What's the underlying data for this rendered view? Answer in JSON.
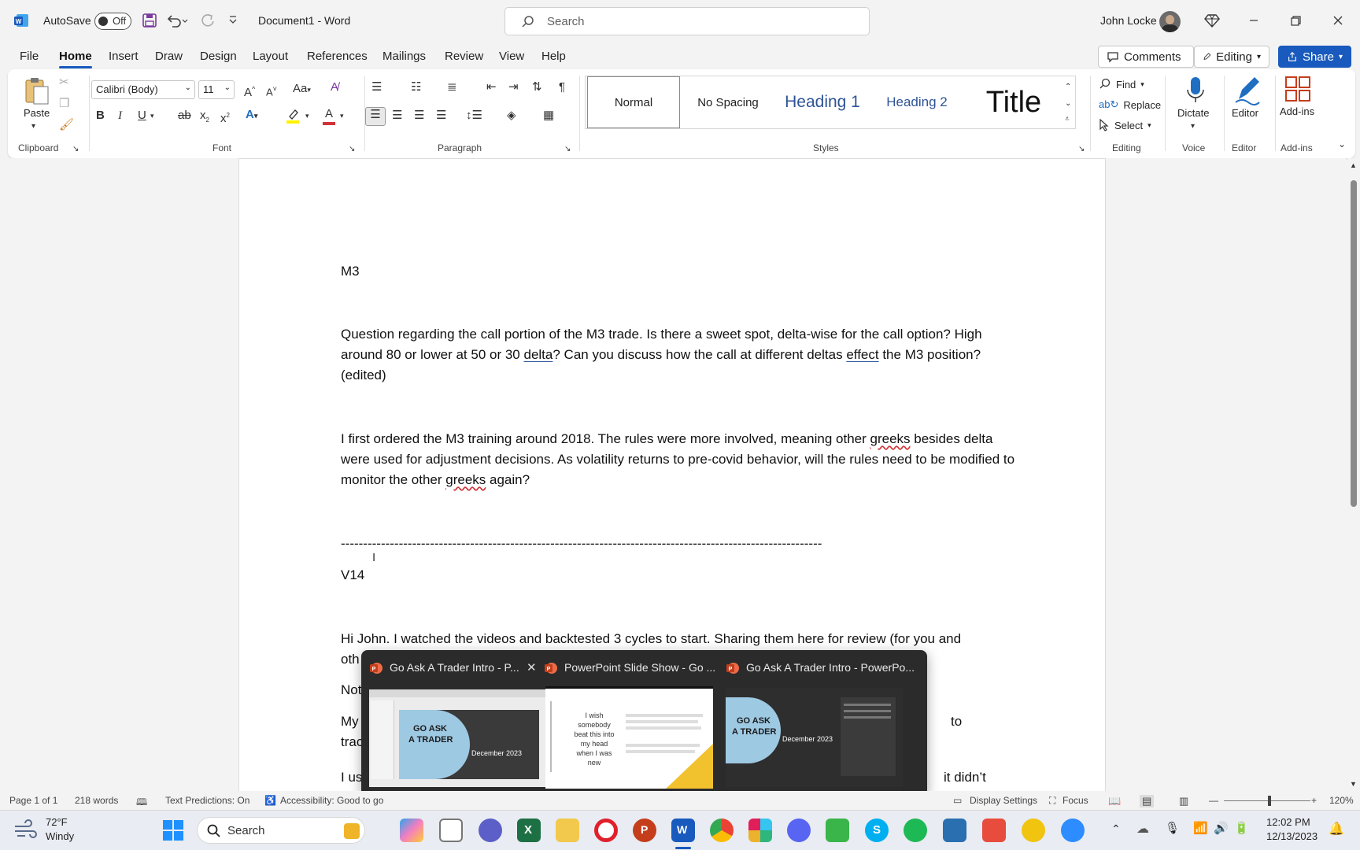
{
  "titlebar": {
    "autosave_label": "AutoSave",
    "autosave_state": "Off",
    "doc_title": "Document1  -  Word",
    "search_placeholder": "Search",
    "user_name": "John Locke"
  },
  "menu": {
    "items": [
      "File",
      "Home",
      "Insert",
      "Draw",
      "Design",
      "Layout",
      "References",
      "Mailings",
      "Review",
      "View",
      "Help"
    ],
    "active": "Home",
    "comments_label": "Comments",
    "editing_label": "Editing",
    "share_label": "Share"
  },
  "ribbon": {
    "clipboard": {
      "paste_label": "Paste",
      "group_label": "Clipboard"
    },
    "font": {
      "font_name": "Calibri (Body)",
      "font_size": "11",
      "group_label": "Font",
      "aa_label": "Aa"
    },
    "paragraph": {
      "group_label": "Paragraph"
    },
    "styles": {
      "items": [
        "Normal",
        "No Spacing",
        "Heading 1",
        "Heading 2",
        "Title"
      ],
      "group_label": "Styles",
      "heading_color": "#2f5496"
    },
    "editing": {
      "find_label": "Find",
      "replace_label": "Replace",
      "select_label": "Select",
      "group_label": "Editing"
    },
    "voice": {
      "dictate_label": "Dictate",
      "group_label": "Voice"
    },
    "editor": {
      "editor_label": "Editor",
      "group_label": "Editor"
    },
    "addins": {
      "addins_label": "Add-ins",
      "group_label": "Add-ins"
    }
  },
  "document": {
    "m3_heading": "M3",
    "q1": {
      "a": "Question regarding the call portion of the M3 trade. Is there a sweet spot, delta-wise for the call option? High around 80 or lower at 50 or 30 ",
      "b": "delta",
      "c": "? Can you discuss how the call at different deltas ",
      "d": "effect",
      "e": " the M3 position? (edited)"
    },
    "q2": {
      "a": "I first ordered the M3 training around 2018. The rules were more involved, meaning other ",
      "b": "greeks",
      "c": " besides delta were used for adjustment decisions. As volatility returns to pre-covid behavior, will the rules need to be modified to monitor the other ",
      "d": "greeks",
      "e": " again?"
    },
    "divider": "------------------------------------------------------------------------------------------------------------",
    "v14_heading": "V14",
    "v14_p1": "Hi John. I watched the videos and backtested 3 cycles to start. Sharing them here for review (for you and",
    "v14_p1_line2": "oth",
    "line_not": "Not",
    "line_my": "My",
    "line_my_end": "to",
    "line_trac": "trac",
    "line_ius": "I us",
    "line_ius_end": "it didn’t"
  },
  "statusbar": {
    "page": "Page 1 of 1",
    "words": "218 words",
    "text_predictions": "Text Predictions: On",
    "accessibility": "Accessibility: Good to go",
    "display_settings": "Display Settings",
    "focus": "Focus",
    "zoom": "120%",
    "zoom_percent": 120
  },
  "taskbar": {
    "weather_temp": "72°F",
    "weather_desc": "Windy",
    "search_label": "Search",
    "time": "12:02 PM",
    "date": "12/13/2023"
  },
  "preview": {
    "windows": [
      {
        "title": "Go Ask A Trader Intro - P...",
        "slide_title_1": "GO ASK",
        "slide_title_2": "A TRADER",
        "slide_date": "December 2023"
      },
      {
        "title": "PowerPoint Slide Show  -  Go ...",
        "slide_quote": "I wish somebody beat this into my head when I was new"
      },
      {
        "title": "Go Ask A Trader Intro - PowerPo...",
        "slide_title_1": "GO ASK",
        "slide_title_2": "A TRADER",
        "slide_date": "December 2023"
      }
    ]
  },
  "colors": {
    "word_blue": "#185abd",
    "ppt_red": "#c43e1c",
    "page_bg": "#ffffff",
    "chrome_bg": "#f3f3f3"
  }
}
